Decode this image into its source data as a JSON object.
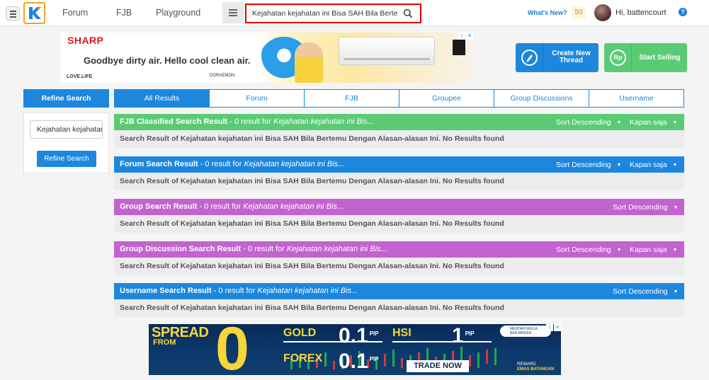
{
  "topbar": {
    "nav": [
      "Forum",
      "FJB",
      "Playground"
    ],
    "search_value": "Kejahatan kejahatan ini Bisa SAH Bila Bertemu Dengan Alasan-alasan Ini",
    "whats_new": "What's New?",
    "notif_count": "50",
    "greeting": "Hi, battencourt",
    "help": "?"
  },
  "ad_top": {
    "brand": "SHARP",
    "slogan": "Goodbye dirty air. Hello cool clean air.",
    "tagline": "LOVE.LIFE",
    "credit": "DORAEMON"
  },
  "actions": {
    "create_thread": "Create New Thread",
    "start_selling": "Start Selling",
    "selling_icon": "Rp"
  },
  "sidebar": {
    "header": "Refine Search",
    "input_value": "Kejahatan kejahatan",
    "button": "Refine Search"
  },
  "tabs": [
    "All Results",
    "Forum",
    "FJB",
    "Groupee",
    "Group Discussions",
    "Username"
  ],
  "sections": [
    {
      "title": "FJB Classified Search Result",
      "count_text": " - 0 result for ",
      "query": "Kejahatan kejahatan ini Bis...",
      "sort": "Sort Descending",
      "time": "Kapan saja",
      "body": "Search Result of Kejahatan kejahatan ini Bisa SAH Bila Bertemu Dengan Alasan-alasan Ini. No Results found"
    },
    {
      "title": "Forum Search Result",
      "count_text": " - 0 result for ",
      "query": "Kejahatan kejahatan ini Bis...",
      "sort": "Sort Descending",
      "time": "Kapan saja",
      "body": "Search Result of Kejahatan kejahatan ini Bisa SAH Bila Bertemu Dengan Alasan-alasan Ini. No Results found"
    },
    {
      "title": "Group Search Result",
      "count_text": " - 0 result for ",
      "query": "Kejahatan kejahatan ini Bis...",
      "sort": "Sort Descending",
      "body": "Search Result of Kejahatan kejahatan ini Bisa SAH Bila Bertemu Dengan Alasan-alasan Ini. No Results found"
    },
    {
      "title": "Group Discussion Search Result",
      "count_text": " - 0 result for ",
      "query": "Kejahatan kejahatan ini Bis...",
      "sort": "Sort Descending",
      "time": "Kapan saja",
      "body": "Search Result of Kejahatan kejahatan ini Bisa SAH Bila Bertemu Dengan Alasan-alasan Ini. No Results found"
    },
    {
      "title": "Username Search Result",
      "count_text": " - 0 result for ",
      "query": "Kejahatan kejahatan ini Bis...",
      "sort": "Sort Descending",
      "body": "Search Result of Kejahatan kejahatan ini Bisa SAH Bila Bertemu Dengan Alasan-alasan Ini. No Results found"
    }
  ],
  "ad_bottom": {
    "spread": "SPREAD",
    "from": "FROM",
    "zero": "0",
    "gold": "GOLD",
    "gold_value": "0.1",
    "hsi": "HSI",
    "hsi_value": "1",
    "forex": "FOREX",
    "forex_value": "0.1",
    "pip": "PIP",
    "trade_now": "TRADE NOW",
    "sponsor": "MENTARI MULIA BERJANGKA",
    "reward_line1": "REWARD",
    "reward_line2": "EMAS BATANGAN"
  },
  "colors": {
    "brand_blue": "#1c87dd",
    "fjb_green": "#5acb74",
    "group_purple": "#c263cf",
    "search_border": "#e00000"
  }
}
